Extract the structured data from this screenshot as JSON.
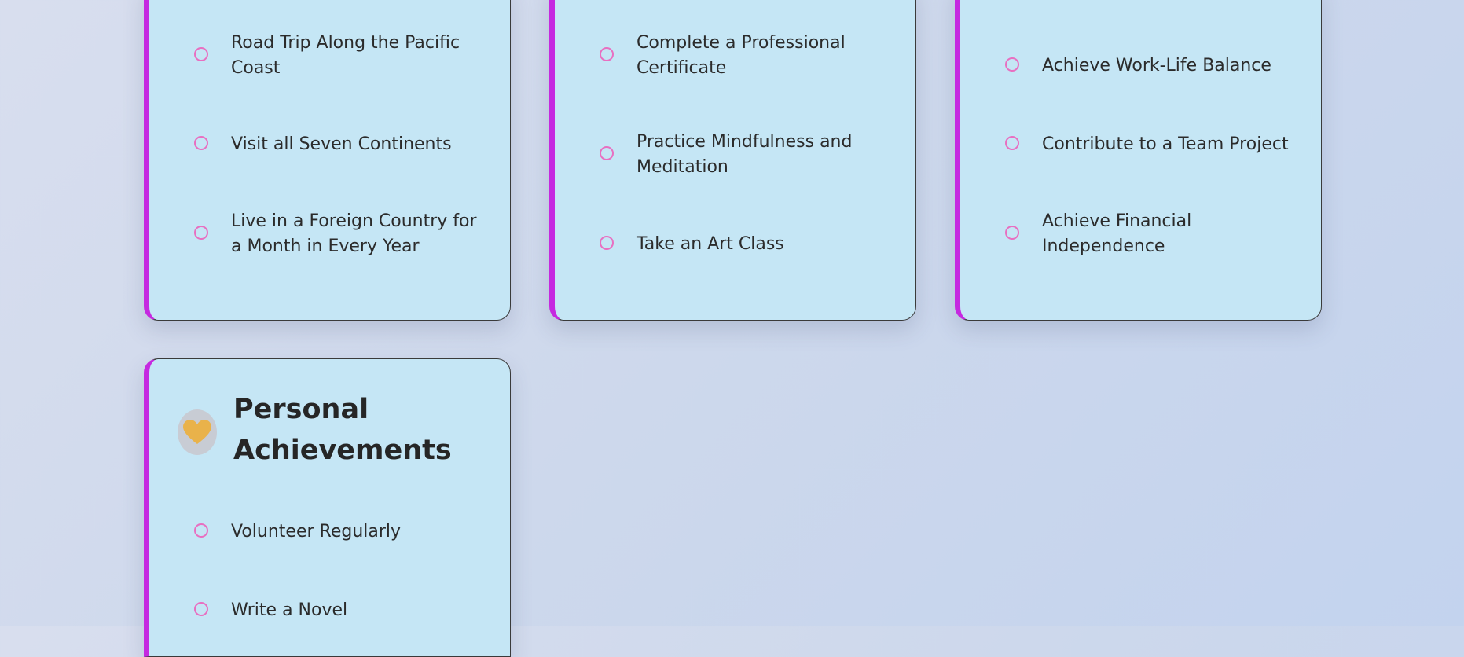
{
  "cards": [
    {
      "goals": [
        "Road Trip Along the Pacific Coast",
        "Visit all Seven Continents",
        "Live in a Foreign Country for a Month in Every Year"
      ]
    },
    {
      "goals": [
        "Complete a Professional Certificate",
        "Practice Mindfulness and Meditation",
        "Take an Art Class"
      ]
    },
    {
      "goals": [
        "Achieve Work-Life Balance",
        "Contribute to a Team Project",
        "Achieve Financial Independence"
      ]
    },
    {
      "title": "Personal Achievements",
      "icon": "heart-icon",
      "goals": [
        "Volunteer Regularly",
        "Write a Novel"
      ]
    }
  ],
  "colors": {
    "card_background": "#c5e6f5",
    "accent_border": "#c529e0",
    "goal_ring": "#e86fc1",
    "heart": "#e9b24a"
  }
}
